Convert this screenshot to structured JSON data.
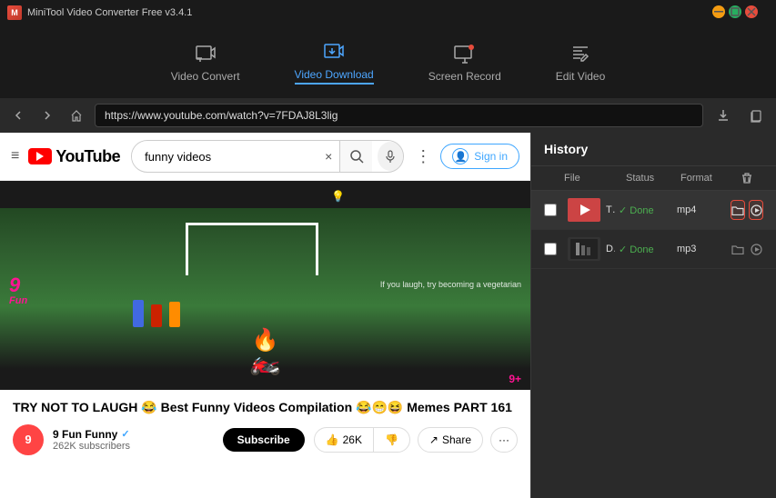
{
  "titleBar": {
    "title": "MiniTool Video Converter Free v3.4.1",
    "icon": "M",
    "controls": {
      "minimize": "−",
      "maximize": "□",
      "close": "×"
    }
  },
  "topNav": {
    "tabs": [
      {
        "id": "video-convert",
        "label": "Video Convert",
        "active": false
      },
      {
        "id": "video-download",
        "label": "Video Download",
        "active": true
      },
      {
        "id": "screen-record",
        "label": "Screen Record",
        "active": false
      },
      {
        "id": "edit-video",
        "label": "Edit Video",
        "active": false
      }
    ]
  },
  "addressBar": {
    "backBtn": "‹",
    "forwardBtn": "›",
    "homeBtn": "⌂",
    "url": "https://www.youtube.com/watch?v=7FDAJ8L3lig",
    "downloadBtn": "⬇",
    "clipboardBtn": "⎘"
  },
  "browser": {
    "youtube": {
      "logo": "YouTube",
      "searchValue": "funny videos",
      "clearBtn": "×",
      "searchPlaceholder": "funny videos",
      "micBtn": "🎤",
      "dotsBtn": "⋮",
      "signIn": "Sign in"
    },
    "video": {
      "title": "TRY NOT TO LAUGH 😂 Best Funny Videos Compilation 😂😁😆 Memes PART 161",
      "overlayText": "If you laugh, try becoming a vegetarian",
      "funBadge": "9 Fun",
      "funBadge2": "9+"
    },
    "channel": {
      "name": "9 Fun Funny",
      "avatar": "9",
      "verified": "✓",
      "subscribers": "262K subscribers",
      "subscribeBtnLabel": "Subscribe",
      "likeCount": "26K",
      "shareLabel": "Share",
      "likeIcon": "👍",
      "dislikeIcon": "👎",
      "shareIcon": "↗",
      "moreIcon": "···"
    }
  },
  "history": {
    "title": "History",
    "columns": {
      "file": "File",
      "status": "Status",
      "format": "Format"
    },
    "rows": [
      {
        "filename": "TRY N...",
        "status": "✓ Done",
        "format": "mp4",
        "highlighted": true,
        "thumbColor": "#e88"
      },
      {
        "filename": "Dream...",
        "status": "✓ Done",
        "format": "mp3",
        "highlighted": false,
        "thumbColor": "#888"
      }
    ],
    "openFolderIcon": "📁",
    "playIcon": "▶",
    "deleteIcon": "🗑"
  }
}
